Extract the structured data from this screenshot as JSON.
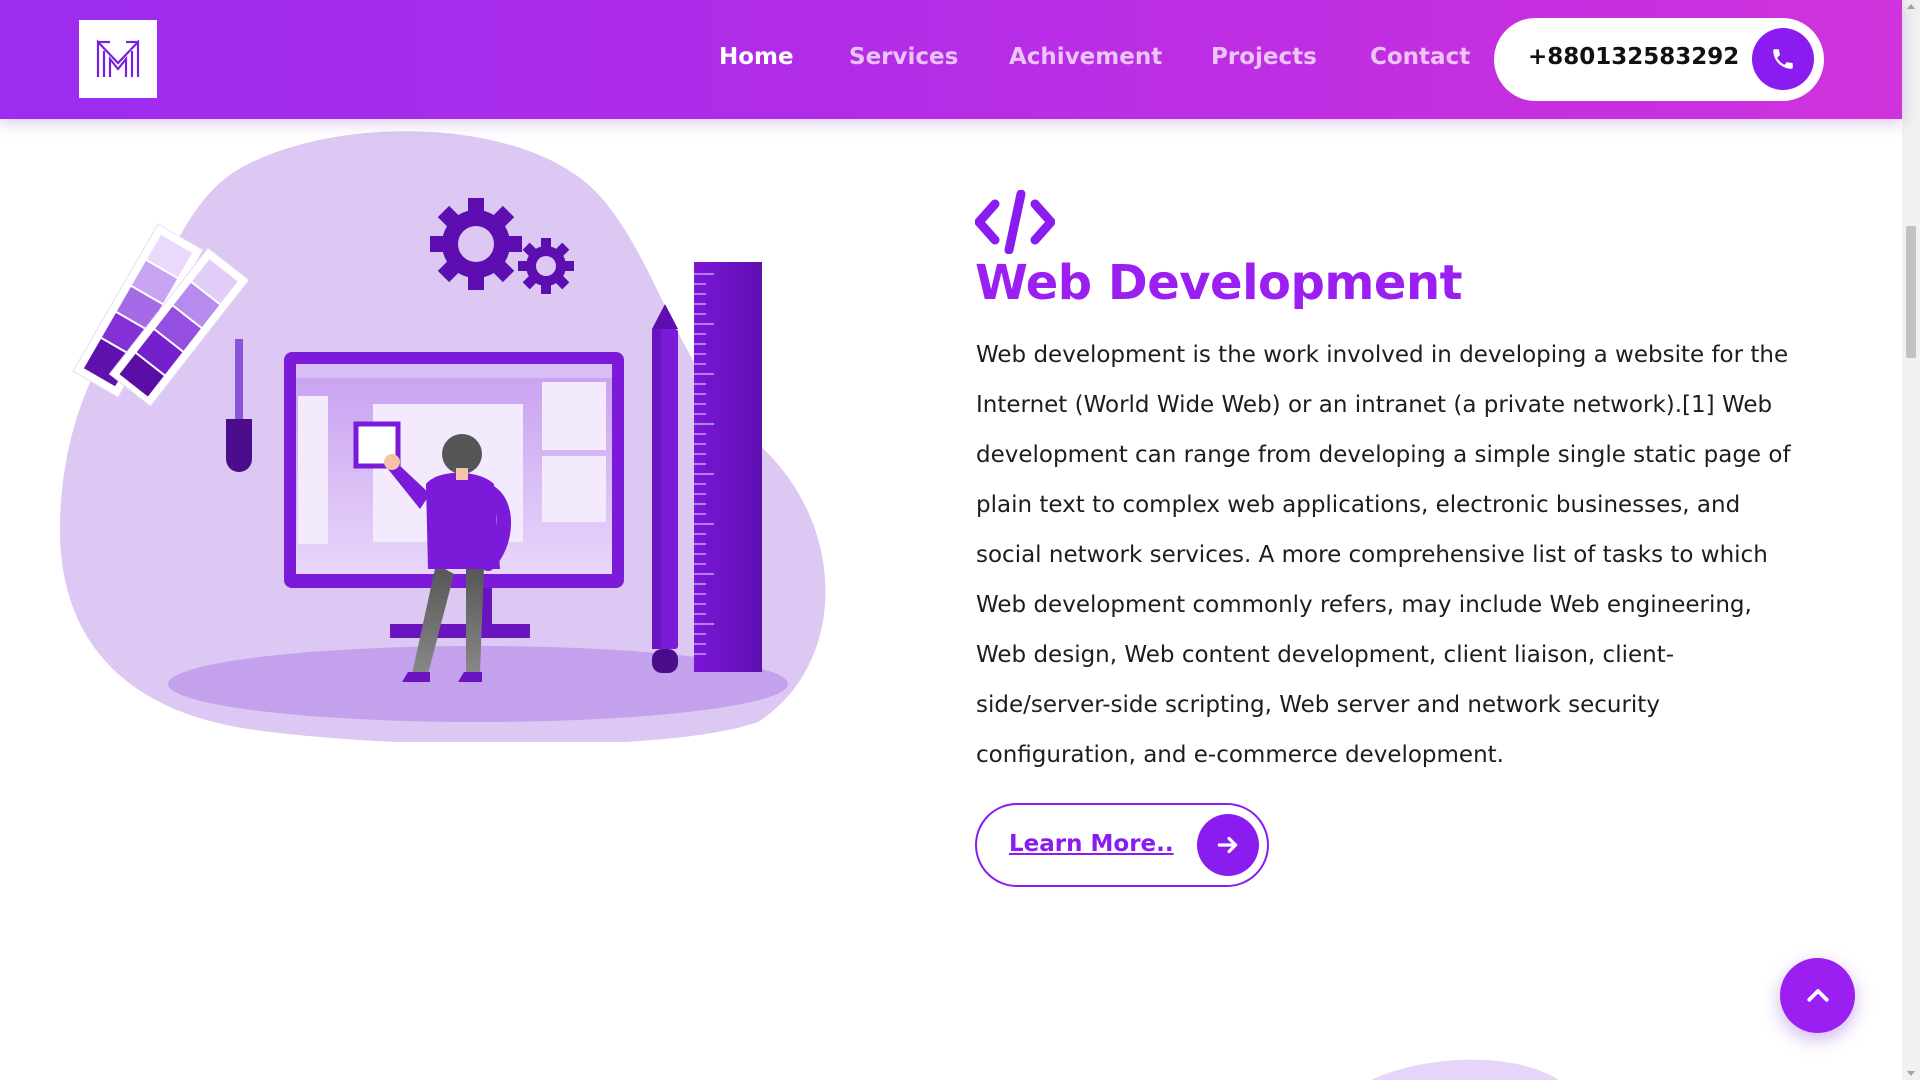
{
  "header": {
    "logo_icon": "m-logo-icon",
    "nav": [
      {
        "label": "Home",
        "active": true
      },
      {
        "label": "Services",
        "active": false
      },
      {
        "label": "Achivement",
        "active": false
      },
      {
        "label": "Projects",
        "active": false
      },
      {
        "label": "Contact",
        "active": false
      }
    ],
    "phone": "+880132583292",
    "phone_icon": "phone-icon"
  },
  "section": {
    "icon": "code-icon",
    "title": "Web Development",
    "body": "Web development is the work involved in developing a website for the Internet (World Wide Web) or an intranet (a private network).[1] Web development can range from developing a simple single static page of plain text to complex web applications, electronic businesses, and social network services. A more comprehensive list of tasks to which Web development commonly refers, may include Web engineering, Web design, Web content development, client liaison, client-side/server-side scripting, Web server and network security configuration, and e-commerce development.",
    "button_label": "Learn More..",
    "button_icon": "arrow-right-icon"
  },
  "scroll_top_icon": "chevron-up-icon",
  "colors": {
    "accent": "#8a1cf0",
    "title": "#9a1ff0",
    "header_start": "#9b2cf0",
    "header_end": "#cf33dc",
    "blob": "#dcc8f2"
  }
}
